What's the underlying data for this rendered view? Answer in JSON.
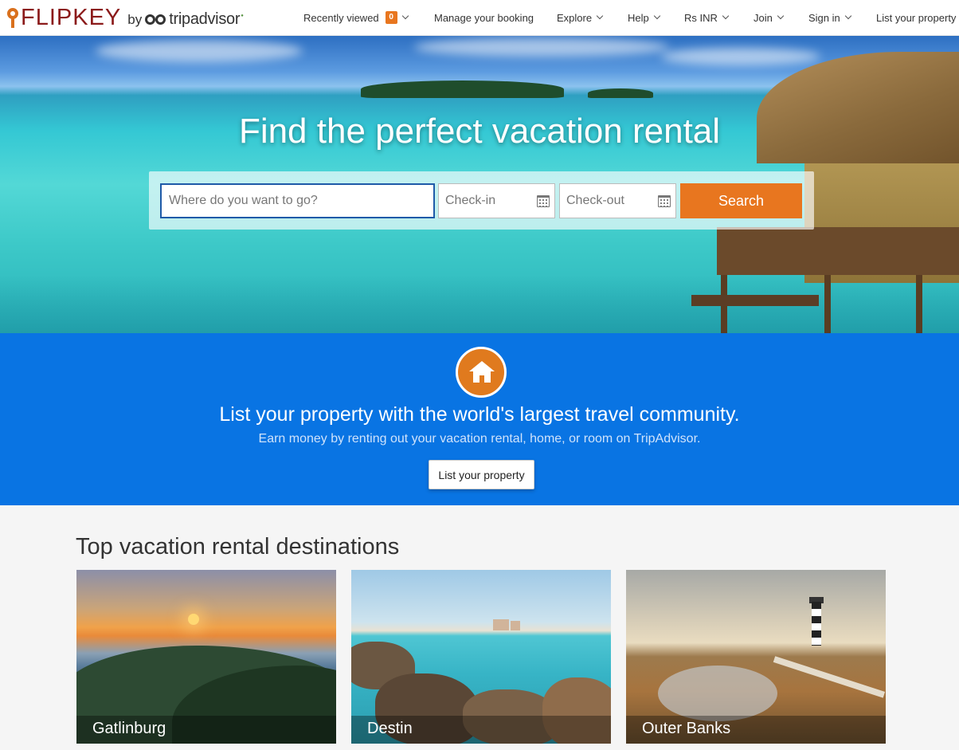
{
  "header": {
    "logo": {
      "brand": "FLIPKEY",
      "by": "by",
      "partner": "tripadvisor"
    },
    "nav": {
      "recently_viewed": "Recently viewed",
      "recently_viewed_count": "0",
      "manage_booking": "Manage your booking",
      "explore": "Explore",
      "help": "Help",
      "currency": "Rs INR",
      "join": "Join",
      "sign_in": "Sign in",
      "list_property": "List your property"
    }
  },
  "hero": {
    "title": "Find the perfect vacation rental",
    "search": {
      "destination_placeholder": "Where do you want to go?",
      "checkin_placeholder": "Check-in",
      "checkout_placeholder": "Check-out",
      "button_label": "Search"
    }
  },
  "list_property": {
    "icon": "house-icon",
    "title": "List your property with the world's largest travel community.",
    "subtitle": "Earn money by renting out your vacation rental, home, or room on TripAdvisor.",
    "button_label": "List your property"
  },
  "destinations": {
    "heading": "Top vacation rental destinations",
    "items": [
      {
        "name": "Gatlinburg"
      },
      {
        "name": "Destin"
      },
      {
        "name": "Outer Banks"
      }
    ]
  },
  "colors": {
    "accent_orange": "#e8761f",
    "band_blue": "#0974e3",
    "brand_red": "#8b1a1a",
    "tripadvisor_green": "#589442"
  }
}
